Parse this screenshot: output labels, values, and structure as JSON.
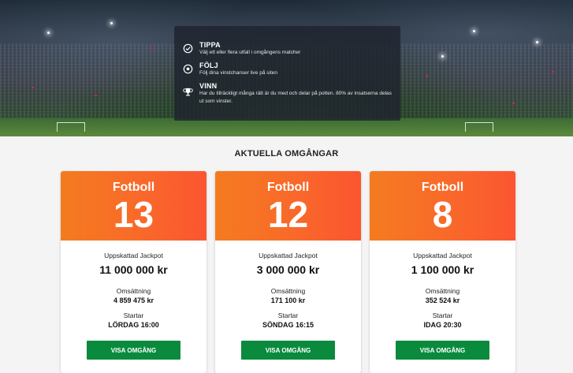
{
  "hero": {
    "items": [
      {
        "icon": "check-circle-icon",
        "title": "TIPPA",
        "text": "Välj ett eller flera utfall i omgångens matcher"
      },
      {
        "icon": "soccer-ball-icon",
        "title": "FÖLJ",
        "text": "Följ dina vinstchanser live på siten"
      },
      {
        "icon": "trophy-icon",
        "title": "VINN",
        "text": "Har du tillräckligt många rätt är du med och delar på potten. 80% av insatserna delas ut som vinster."
      }
    ]
  },
  "section_title": "AKTUELLA OMGÅNGAR",
  "colors": {
    "accent_start": "#f47b20",
    "accent_end": "#fb5530",
    "button": "#0a8a3d"
  },
  "cards": [
    {
      "sport": "Fotboll",
      "number": "13",
      "jackpot_label": "Uppskattad Jackpot",
      "jackpot": "11 000 000 kr",
      "turnover_label": "Omsättning",
      "turnover": "4 859 475 kr",
      "start_label": "Startar",
      "start": "LÖRDAG 16:00",
      "button": "VISA OMGÅNG"
    },
    {
      "sport": "Fotboll",
      "number": "12",
      "jackpot_label": "Uppskattad Jackpot",
      "jackpot": "3 000 000 kr",
      "turnover_label": "Omsättning",
      "turnover": "171 100 kr",
      "start_label": "Startar",
      "start": "SÖNDAG 16:15",
      "button": "VISA OMGÅNG"
    },
    {
      "sport": "Fotboll",
      "number": "8",
      "jackpot_label": "Uppskattad Jackpot",
      "jackpot": "1 100 000 kr",
      "turnover_label": "Omsättning",
      "turnover": "352 524 kr",
      "start_label": "Startar",
      "start": "IDAG 20:30",
      "button": "VISA OMGÅNG"
    }
  ]
}
